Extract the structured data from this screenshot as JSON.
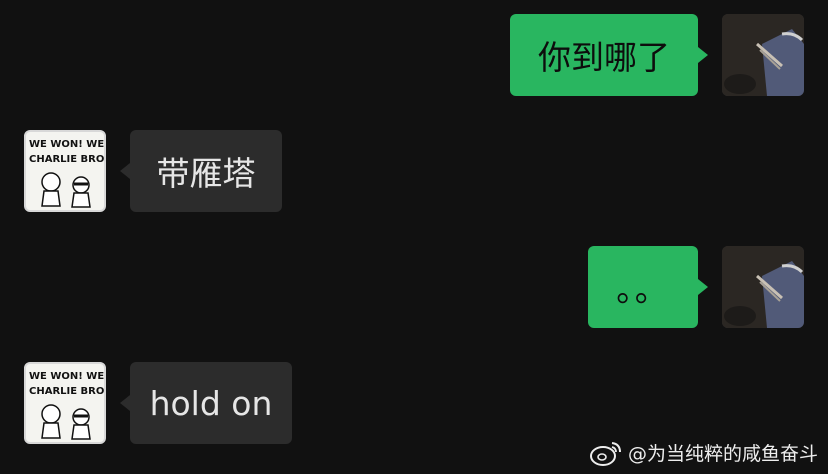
{
  "messages": [
    {
      "side": "sent",
      "text": "你到哪了",
      "avatar": "user-photo-avatar"
    },
    {
      "side": "received",
      "text": "带雁塔",
      "avatar": "charlie-brown-comic-avatar"
    },
    {
      "side": "sent",
      "text": "。。",
      "avatar": "user-photo-avatar"
    },
    {
      "side": "received",
      "text": "hold on",
      "avatar": "charlie-brown-comic-avatar"
    }
  ],
  "comic_avatar": {
    "line1": "WE WON! WE WON,",
    "line2": "CHARLIE BROWN!!"
  },
  "watermark": {
    "icon": "weibo-icon",
    "text": "@为当纯粹的咸鱼奋斗"
  },
  "colors": {
    "background": "#111111",
    "sent_bubble": "#29b660",
    "received_bubble": "#2c2c2c"
  }
}
